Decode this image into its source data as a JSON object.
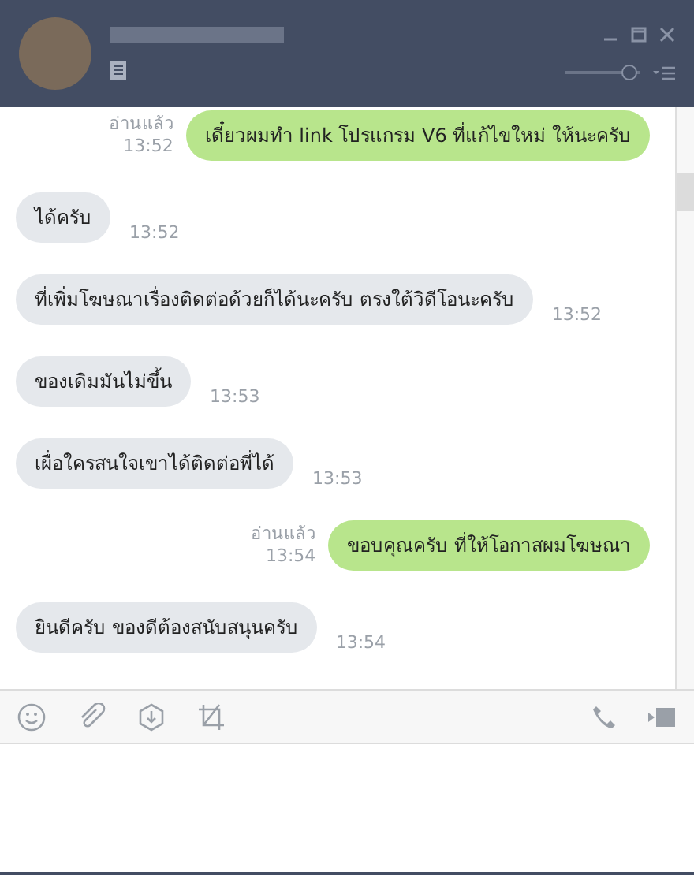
{
  "header": {
    "opacity_slider": {
      "level": 0.85
    }
  },
  "messages": [
    {
      "kind": "sent",
      "text": "เดี๋ยวผมทำ link โปรแกรม V6 ที่แก้ไขใหม่ ให้นะครับ",
      "read": "อ่านแล้ว",
      "time": "13:52"
    },
    {
      "kind": "received",
      "text": "ได้ครับ",
      "time": "13:52"
    },
    {
      "kind": "received",
      "text": "ที่เพิ่มโฆษณาเรื่องติดต่อด้วยก็ได้นะครับ ตรงใต้วิดีโอนะครับ",
      "time": "13:52"
    },
    {
      "kind": "received",
      "text": "ของเดิมมันไม่ขึ้น",
      "time": "13:53"
    },
    {
      "kind": "received",
      "text": "เผื่อใครสนใจเขาได้ติดต่อพี่ได้",
      "time": "13:53"
    },
    {
      "kind": "sent",
      "text": "ขอบคุณครับ ที่ให้โอกาสผมโฆษณา",
      "read": "อ่านแล้ว",
      "time": "13:54"
    },
    {
      "kind": "received",
      "text": "ยินดีครับ ของดีต้องสนับสนุนครับ",
      "time": "13:54"
    }
  ]
}
